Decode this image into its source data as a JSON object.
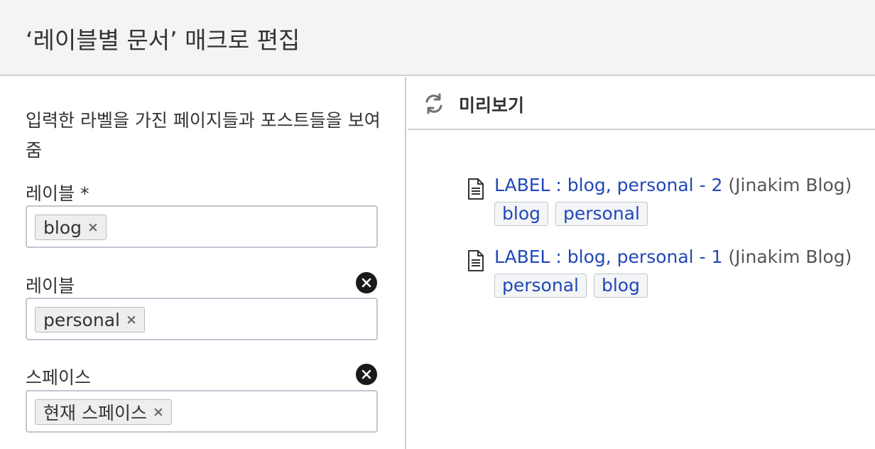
{
  "header": {
    "title": "‘레이블별 문서’ 매크로 편집"
  },
  "form": {
    "description": "입력한 라벨을 가진 페이지들과 포스트들을 보여줌",
    "fields": [
      {
        "label": "레이블 *",
        "chips": [
          "blog"
        ],
        "clearable": false
      },
      {
        "label": "레이블",
        "chips": [
          "personal"
        ],
        "clearable": true
      },
      {
        "label": "스페이스",
        "chips": [
          "현재 스페이스"
        ],
        "clearable": true
      }
    ]
  },
  "preview": {
    "label": "미리보기",
    "results": [
      {
        "title": "LABEL : blog, personal - 2",
        "space": "(Jinakim Blog)",
        "tags": [
          "blog",
          "personal"
        ]
      },
      {
        "title": "LABEL : blog, personal - 1",
        "space": "(Jinakim Blog)",
        "tags": [
          "personal",
          "blog"
        ]
      }
    ]
  },
  "icons": {
    "chip_remove": "×",
    "clear": "close-circle-icon",
    "refresh": "refresh-icon",
    "document": "page-icon"
  },
  "colors": {
    "link": "#2148b8",
    "header_bg": "#f4f4f4",
    "border": "#cfcfcf"
  }
}
